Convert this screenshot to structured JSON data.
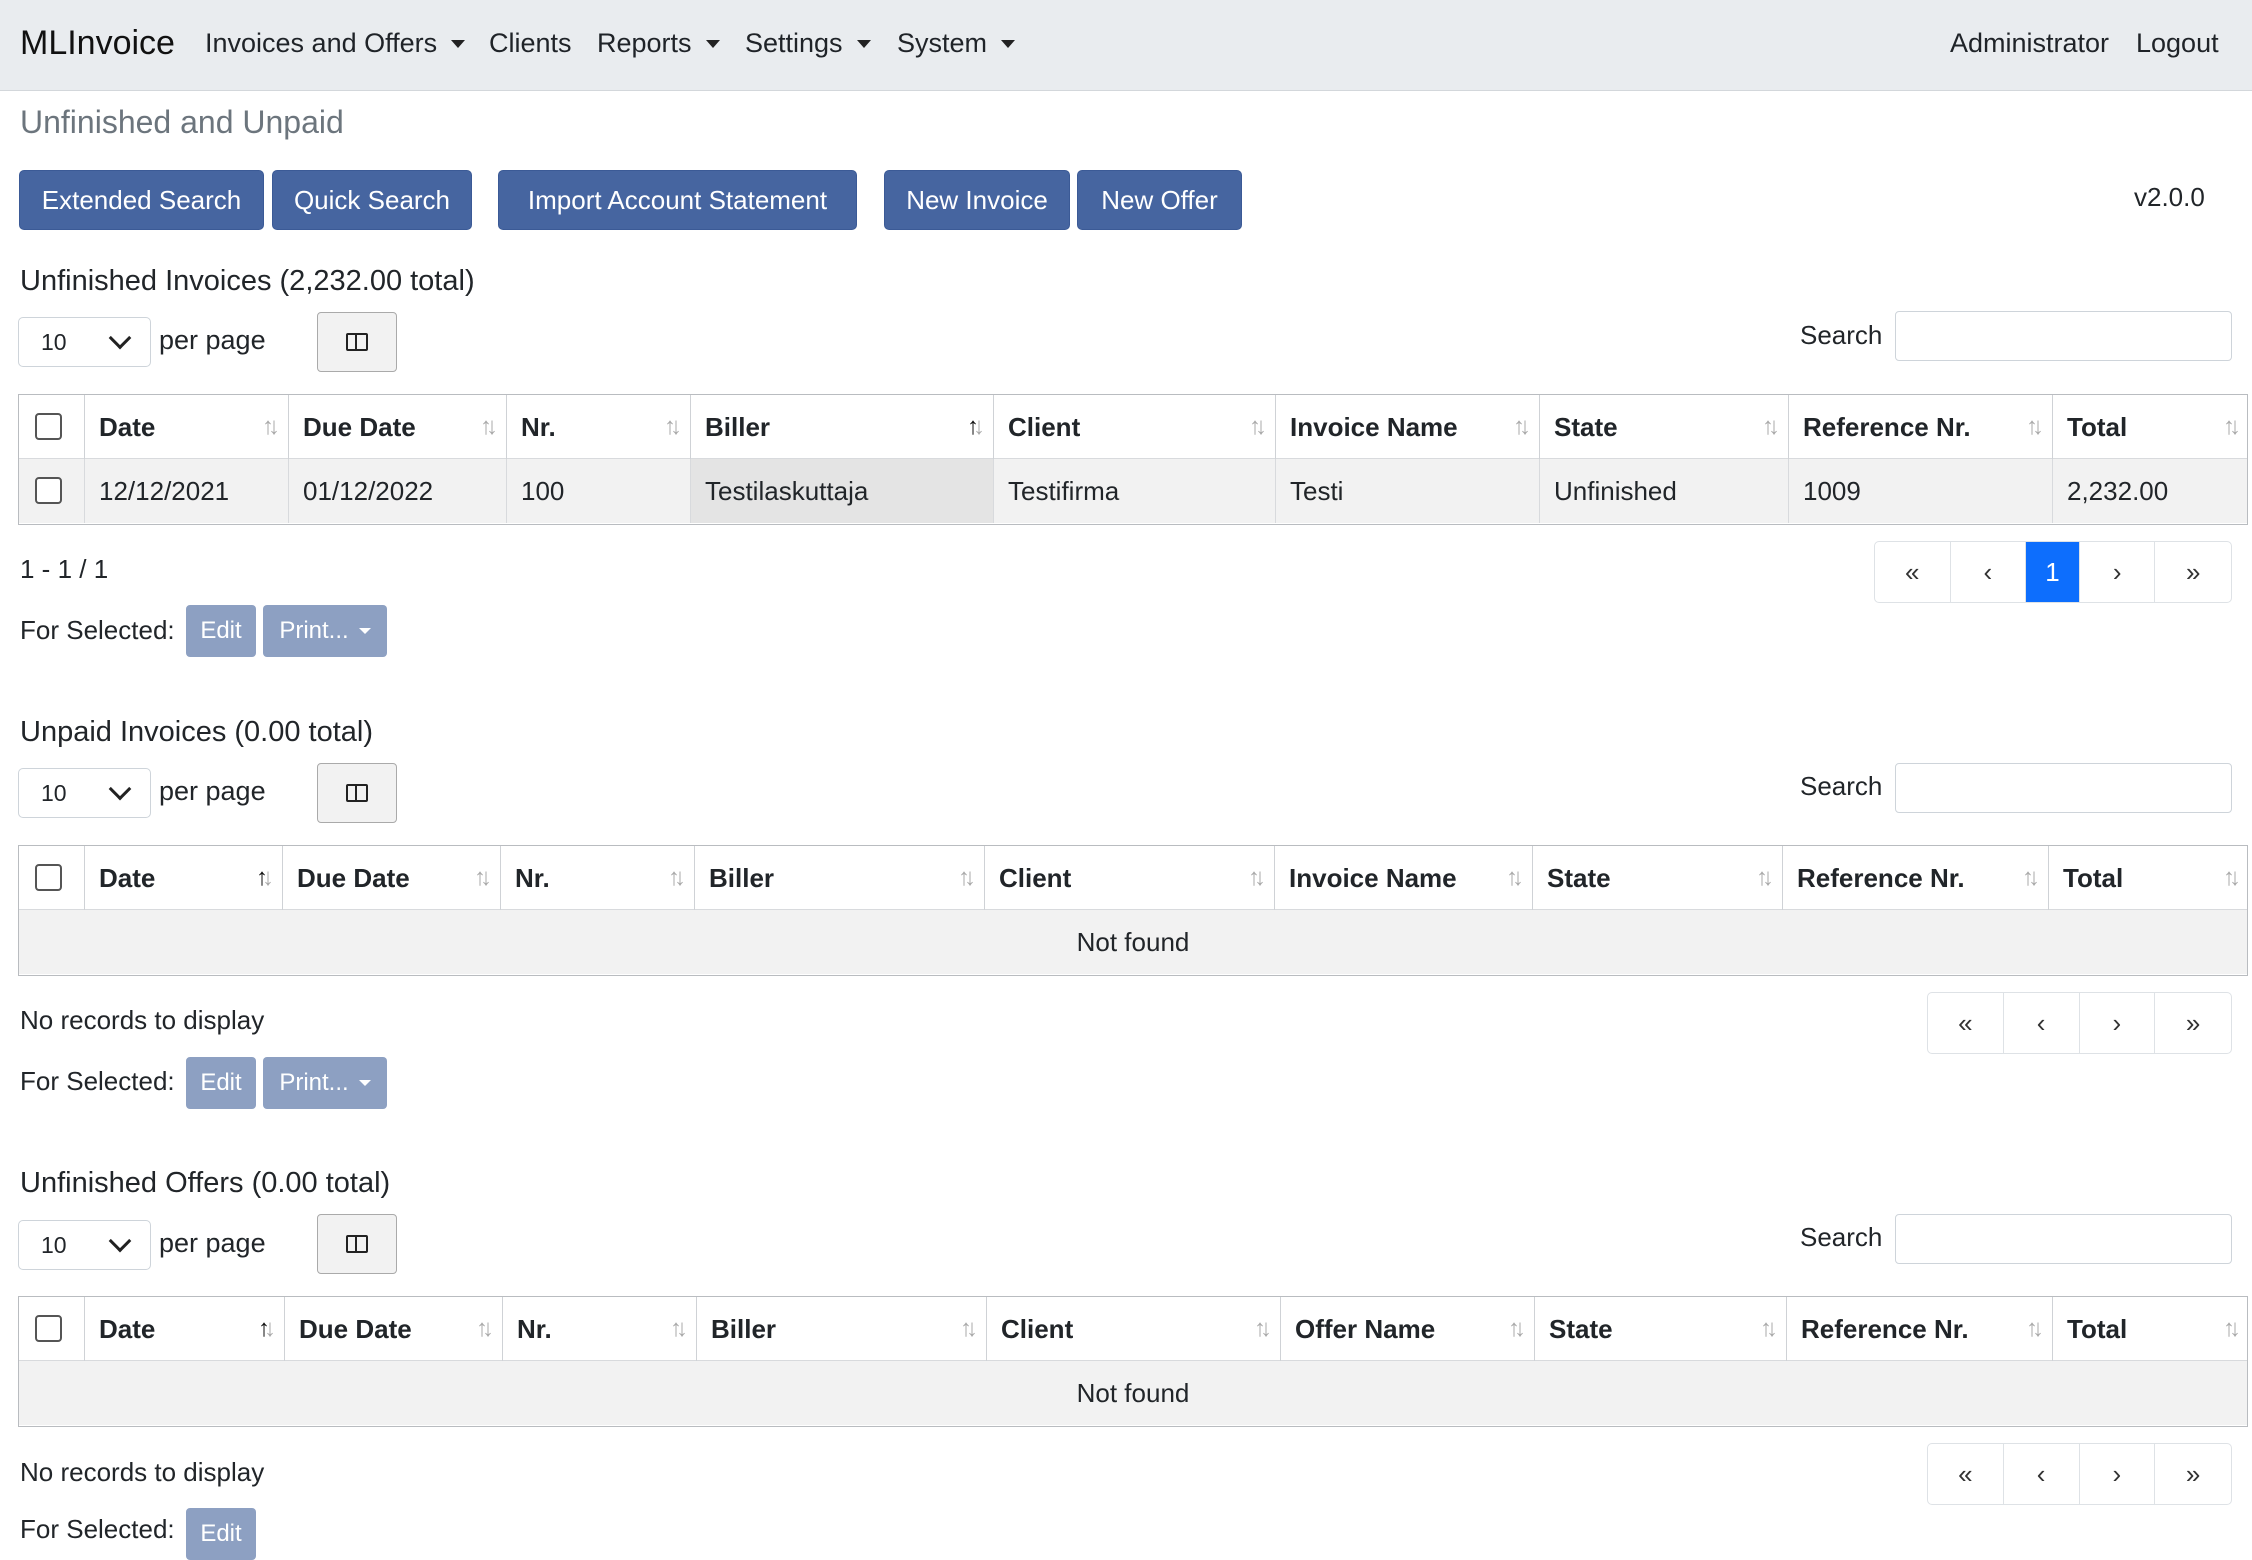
{
  "navbar": {
    "brand": "MLInvoice",
    "items": [
      {
        "label": "Invoices and Offers",
        "dropdown": true
      },
      {
        "label": "Clients",
        "dropdown": false
      },
      {
        "label": "Reports",
        "dropdown": true
      },
      {
        "label": "Settings",
        "dropdown": true
      },
      {
        "label": "System",
        "dropdown": true
      }
    ],
    "user": "Administrator",
    "logout": "Logout"
  },
  "page_title": "Unfinished and Unpaid",
  "toolbar": {
    "extended_search": "Extended Search",
    "quick_search": "Quick Search",
    "import_statement": "Import Account Statement",
    "new_invoice": "New Invoice",
    "new_offer": "New Offer",
    "version": "v2.0.0"
  },
  "common": {
    "per_page_value": "10",
    "per_page_label": "per page",
    "search_label": "Search",
    "search_placeholder": "",
    "for_selected": "For Selected:",
    "edit": "Edit",
    "print": "Print...",
    "pager": {
      "first": "«",
      "prev": "‹",
      "next": "›",
      "last": "»"
    }
  },
  "sections": {
    "unfinished_invoices": {
      "title": "Unfinished Invoices (2,232.00 total)",
      "columns": [
        "Date",
        "Due Date",
        "Nr.",
        "Biller",
        "Client",
        "Invoice Name",
        "State",
        "Reference Nr.",
        "Total"
      ],
      "rows": [
        {
          "date": "12/12/2021",
          "due_date": "01/12/2022",
          "nr": "100",
          "biller": "Testilaskuttaja",
          "client": "Testifirma",
          "name": "Testi",
          "state": "Unfinished",
          "ref": "1009",
          "total": "2,232.00"
        }
      ],
      "info": "1 - 1 / 1",
      "current_page": "1"
    },
    "unpaid_invoices": {
      "title": "Unpaid Invoices (0.00 total)",
      "columns": [
        "Date",
        "Due Date",
        "Nr.",
        "Biller",
        "Client",
        "Invoice Name",
        "State",
        "Reference Nr.",
        "Total"
      ],
      "empty": "Not found",
      "info": "No records to display"
    },
    "unfinished_offers": {
      "title": "Unfinished Offers (0.00 total)",
      "columns": [
        "Date",
        "Due Date",
        "Nr.",
        "Biller",
        "Client",
        "Offer Name",
        "State",
        "Reference Nr.",
        "Total"
      ],
      "empty": "Not found",
      "info": "No records to display"
    }
  }
}
